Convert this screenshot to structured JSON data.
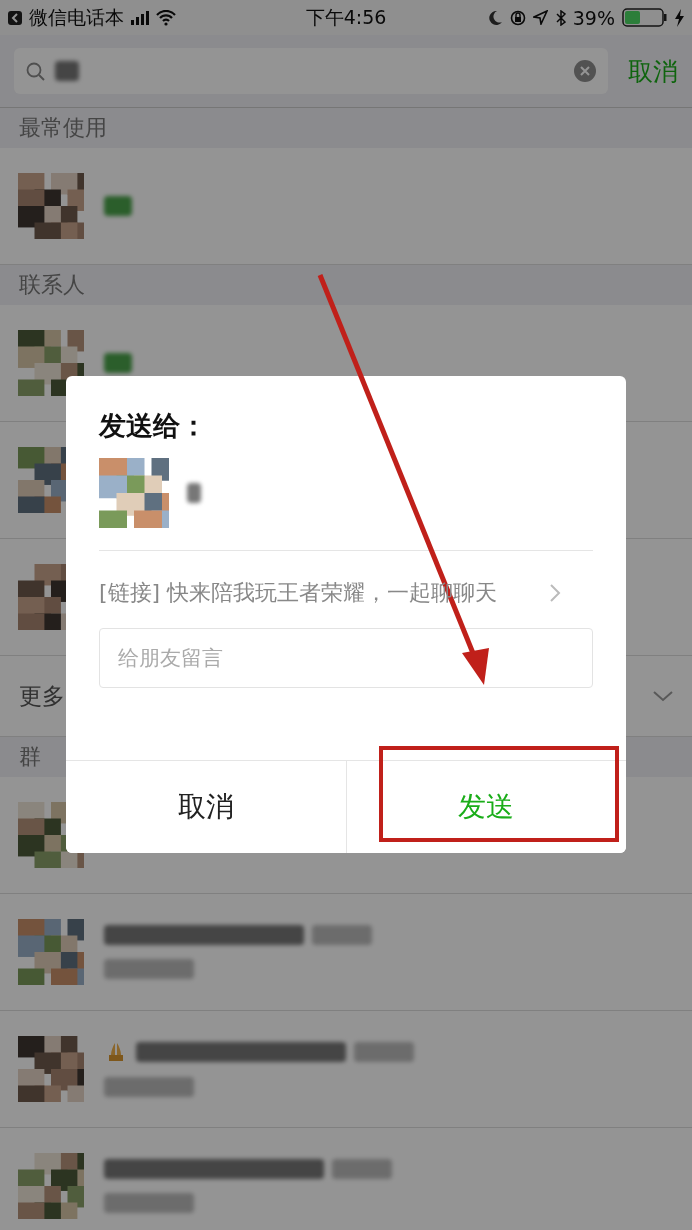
{
  "status_bar": {
    "back_app": "微信电话本",
    "time": "下午4:56",
    "battery": "39%"
  },
  "search": {
    "cancel": "取消"
  },
  "sections": [
    {
      "title": "最常使用",
      "rows": [
        {
          "kind": "single"
        }
      ]
    },
    {
      "title": "联系人",
      "rows": [
        {
          "kind": "single"
        },
        {
          "kind": "covered"
        },
        {
          "kind": "covered"
        }
      ],
      "more": "更多"
    },
    {
      "title": "群",
      "rows": [
        {
          "kind": "covered"
        },
        {
          "kind": "group"
        },
        {
          "kind": "group-emoji"
        },
        {
          "kind": "group"
        }
      ]
    }
  ],
  "dialog": {
    "title": "发送给：",
    "message": "[链接] 快来陪我玩王者荣耀，一起聊聊天",
    "comment": {
      "placeholder": "给朋友留言"
    },
    "buttons": [
      {
        "label": "取消",
        "kind": "cancel"
      },
      {
        "label": "发送",
        "kind": "confirm"
      }
    ]
  }
}
